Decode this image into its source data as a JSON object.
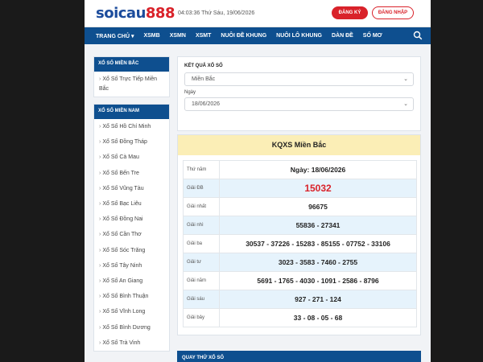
{
  "header": {
    "logo_part1": "soicau",
    "logo_part2": "888",
    "datetime": "04:03:36 Thứ Sáu, 19/06/2026",
    "register_label": "ĐĂNG KÝ",
    "login_label": "ĐĂNG NHẬP"
  },
  "nav": {
    "items": [
      "TRANG CHỦ ▾",
      "XSMB",
      "XSMN",
      "XSMT",
      "NUÔI ĐỀ KHUNG",
      "NUÔI LÔ KHUNG",
      "DÀN ĐỀ",
      "SỐ MƠ"
    ],
    "search_icon": "search-icon"
  },
  "sidebar": {
    "north": {
      "title": "XỔ SỐ MIỀN BẮC",
      "items": [
        "Xổ Số Trực Tiếp Miền Bắc"
      ]
    },
    "south": {
      "title": "XỔ SỐ MIỀN NAM",
      "items": [
        "Xổ Số Hồ Chí Minh",
        "Xổ Số Đồng Tháp",
        "Xổ Số Cà Mau",
        "Xổ Số Bến Tre",
        "Xổ Số Vũng Tàu",
        "Xổ Số Bạc Liêu",
        "Xổ Số Đồng Nai",
        "Xổ Số Cần Thơ",
        "Xổ Số Sóc Trăng",
        "Xổ Số Tây Ninh",
        "Xổ Số An Giang",
        "Xổ Số Bình Thuận",
        "Xổ Số Vĩnh Long",
        "Xổ Số Bình Dương",
        "Xổ Số Trà Vinh"
      ]
    }
  },
  "filter": {
    "title": "KẾT QUẢ XỔ SỐ",
    "region_value": "Miền Bắc",
    "date_label": "Ngày",
    "date_value": "18/06/2026"
  },
  "result": {
    "title": "KQXS Miền Bắc",
    "rows": [
      {
        "label": "Thứ năm",
        "value": "Ngày: 18/06/2026"
      },
      {
        "label": "Giải ĐB",
        "value": "15032"
      },
      {
        "label": "Giải nhất",
        "value": "96675"
      },
      {
        "label": "Giải nhì",
        "value": "55836 - 27341"
      },
      {
        "label": "Giải ba",
        "value": "30537 - 37226 - 15283 - 85155 - 07752 - 33106"
      },
      {
        "label": "Giải tư",
        "value": "3023 - 3583 - 7460 - 2755"
      },
      {
        "label": "Giải năm",
        "value": "5691 - 1765 - 4030 - 1091 - 2586 - 8796"
      },
      {
        "label": "Giải sáu",
        "value": "927 - 271 - 124"
      },
      {
        "label": "Giải bảy",
        "value": "33 - 08 - 05 - 68"
      }
    ]
  },
  "quay": {
    "title": "QUAY THỬ XỔ SỐ"
  },
  "colors": {
    "brand_blue": "#0e4f8f",
    "brand_red": "#d9222a",
    "header_yellow": "#fbeeb6"
  }
}
